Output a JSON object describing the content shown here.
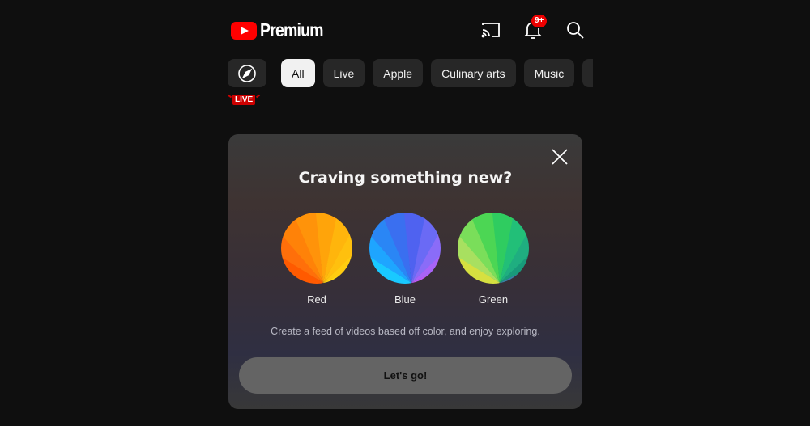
{
  "header": {
    "logo_text": "Premium",
    "notification_count": "9+",
    "icons": [
      "cast-icon",
      "bell-icon",
      "search-icon"
    ]
  },
  "chips": {
    "explore_icon": "compass-icon",
    "items": [
      {
        "label": "All",
        "active": true
      },
      {
        "label": "Live",
        "active": false
      },
      {
        "label": "Apple",
        "active": false
      },
      {
        "label": "Culinary arts",
        "active": false
      },
      {
        "label": "Music",
        "active": false
      },
      {
        "label": "N",
        "active": false
      }
    ],
    "live_badge": "LIVE"
  },
  "modal": {
    "title": "Craving something new?",
    "options": [
      {
        "label": "Red",
        "colors": [
          "#ff5a00",
          "#ff6f0a",
          "#ff8208",
          "#ff930a",
          "#ffa40a",
          "#ffb50c",
          "#ffc00e",
          "#ffcc10",
          "#ffd812"
        ]
      },
      {
        "label": "Blue",
        "colors": [
          "#19c9ff",
          "#1ea5ff",
          "#2a86f5",
          "#3a6ff0",
          "#4f62f0",
          "#6a6af5",
          "#8a6cf8",
          "#a864f8",
          "#bf5af5"
        ]
      },
      {
        "label": "Green",
        "colors": [
          "#d6e040",
          "#a8e060",
          "#7ade5a",
          "#4cd654",
          "#2fcc60",
          "#22bf78",
          "#1fae80",
          "#189a7a",
          "#3a7fa8"
        ]
      }
    ],
    "description": "Create a feed of videos based off color, and enjoy exploring.",
    "cta_label": "Let's go!"
  }
}
